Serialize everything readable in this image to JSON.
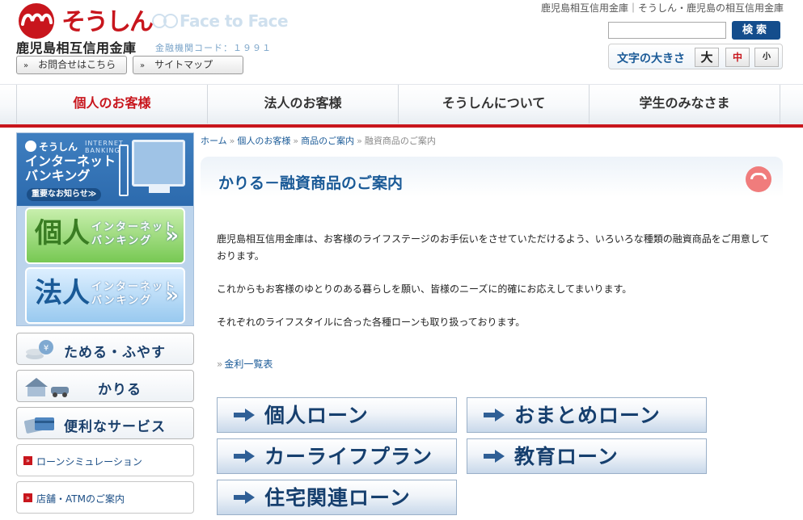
{
  "header": {
    "brand": "そうしん",
    "face_to_face": "Face to Face",
    "bank_name": "鹿児島相互信用金庫",
    "bank_code": "金融機関コード：１９９１",
    "tagline": "鹿児島相互信用金庫｜そうしん・鹿児島の相互信用金庫",
    "contact_label": "お問合せはこちら",
    "sitemap_label": "サイトマップ",
    "search_placeholder": "",
    "search_button": "検索",
    "font_size_label": "文字の大きさ",
    "font_sizes": [
      "大",
      "中",
      "小"
    ],
    "active_font_size": "中",
    "accent_color": "#c8161d"
  },
  "nav": {
    "items": [
      "個人のお客様",
      "法人のお客様",
      "そうしんについて",
      "学生のみなさま"
    ],
    "active": "個人のお客様"
  },
  "sidebar": {
    "internet_banking": {
      "logo_text": "そうしん",
      "english": "INTERNET BANKING",
      "title_line1": "インターネット",
      "title_line2": "バンキング",
      "notice": "重要なお知らせ≫",
      "personal_big": "個人",
      "personal_sub1": "インターネット",
      "personal_sub2": "バンキング",
      "corporate_big": "法人",
      "corporate_sub1": "インターネット",
      "corporate_sub2": "バンキング"
    },
    "categories": [
      "ためる・ふやす",
      "かりる",
      "便利なサービス"
    ],
    "links": [
      "ローンシミュレーション",
      "店舗・ATMのご案内"
    ]
  },
  "breadcrumb": [
    "ホーム",
    "個人のお客様",
    "商品のご案内",
    "融資商品のご案内"
  ],
  "main": {
    "title": "かりる－融資商品のご案内",
    "paragraphs": [
      "鹿児島相互信用金庫は、お客様のライフステージのお手伝いをさせていただけるよう、いろいろな種類の融資商品をご用意しております。",
      "これからもお客様のゆとりのある暮らしを願い、皆様のニーズに的確にお応えしてまいります。",
      "それぞれのライフスタイルに合った各種ローンも取り扱っております。"
    ],
    "rate_link": "金利一覧表",
    "loan_buttons": [
      "個人ローン",
      "おまとめローン",
      "カーライフプラン",
      "教育ローン",
      "住宅関連ローン"
    ]
  }
}
